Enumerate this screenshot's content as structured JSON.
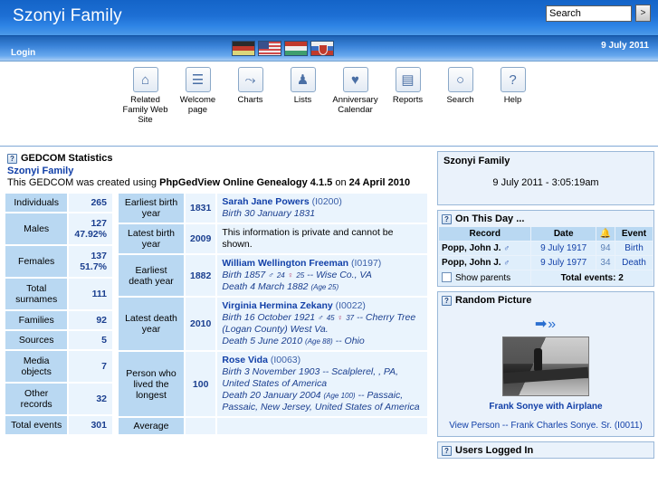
{
  "header": {
    "site_title": "Szonyi Family",
    "search_value": "Search",
    "search_go_label": ">",
    "login_label": "Login",
    "date": "9 July 2011",
    "flags": [
      "german-flag",
      "usa-flag",
      "hungary-flag",
      "slovakia-flag"
    ]
  },
  "toolbar": [
    {
      "icon": "home-icon",
      "glyph": "⌂",
      "label": "Related Family Web Site"
    },
    {
      "icon": "list-lines-icon",
      "glyph": "☰",
      "label": "Welcome page"
    },
    {
      "icon": "chart-icon",
      "glyph": "⤳",
      "label": "Charts"
    },
    {
      "icon": "person-icon",
      "glyph": "♟",
      "label": "Lists"
    },
    {
      "icon": "calendar-heart-icon",
      "glyph": "♥",
      "label": "Anniversary Calendar"
    },
    {
      "icon": "report-icon",
      "glyph": "▤",
      "label": "Reports"
    },
    {
      "icon": "magnifier-icon",
      "glyph": "○",
      "label": "Search"
    },
    {
      "icon": "question-icon",
      "glyph": "?",
      "label": "Help"
    }
  ],
  "gedcom": {
    "panel_title": "GEDCOM Statistics",
    "help_glyph": "?",
    "family_link": "Szonyi Family",
    "desc_prefix": "This GEDCOM was created using ",
    "desc_software": "PhpGedView Online Genealogy 4.1.5",
    "desc_mid": " on ",
    "desc_date": "24 April 2010"
  },
  "stats_left": [
    {
      "label": "Individuals",
      "value": "265"
    },
    {
      "label": "Males",
      "value": "127\n47.92%"
    },
    {
      "label": "Females",
      "value": "137\n51.7%"
    },
    {
      "label": "Total surnames",
      "value": "111"
    },
    {
      "label": "Families",
      "value": "92"
    },
    {
      "label": "Sources",
      "value": "5"
    },
    {
      "label": "Media objects",
      "value": "7"
    },
    {
      "label": "Other records",
      "value": "32"
    },
    {
      "label": "Total events",
      "value": "301"
    }
  ],
  "stats_right": [
    {
      "label": "Earliest birth year",
      "value": "1831",
      "private": false,
      "name": "Sarah Jane Powers",
      "xref": "(I0200)",
      "lines": [
        {
          "text": "Birth 30 January 1831"
        }
      ]
    },
    {
      "label": "Latest birth year",
      "value": "2009",
      "private": true,
      "private_text": "This information is private and cannot be shown."
    },
    {
      "label": "Earliest death year",
      "value": "1882",
      "private": false,
      "name": "William Wellington Freeman",
      "xref": "(I0197)",
      "lines": [
        {
          "text": "Birth 1857",
          "male_age": "24",
          "female_age": "25",
          "tail": "-- Wise Co., VA"
        },
        {
          "text": "Death 4 March 1882",
          "age": "(Age 25)"
        }
      ]
    },
    {
      "label": "Latest death year",
      "value": "2010",
      "private": false,
      "name": "Virginia Hermina Zekany",
      "xref": "(I0022)",
      "lines": [
        {
          "text": "Birth 16 October 1921",
          "male_age": "45",
          "female_age": "37",
          "tail": "-- Cherry Tree (Logan County) West Va."
        },
        {
          "text": "Death 5 June 2010",
          "age": "(Age 88)",
          "tail": "-- Ohio"
        }
      ]
    },
    {
      "label": "Person who lived the longest",
      "value": "100",
      "private": false,
      "name": "Rose Vida",
      "xref": "(I0063)",
      "lines": [
        {
          "text": "Birth 3 November 1903 -- Scalplerel, , PA, United States of America"
        },
        {
          "text": "Death 20 January 2004",
          "age": "(Age 100)",
          "tail": "-- Passaic, Passaic, New Jersey, United States of America"
        }
      ]
    },
    {
      "label": "Average",
      "value": "",
      "private": false,
      "name": "",
      "xref": "",
      "lines": []
    }
  ],
  "welcome_block": {
    "title": "Szonyi Family",
    "time": "9 July 2011 - 3:05:19am"
  },
  "on_this_day": {
    "panel_title": "On This Day ...",
    "help_glyph": "?",
    "columns": [
      "Record",
      "Date",
      "bell-icon",
      "Event"
    ],
    "rows": [
      {
        "record": "Popp, John J.",
        "sex": "♂",
        "date": "9 July 1917",
        "age": "94",
        "event": "Birth"
      },
      {
        "record": "Popp, John J.",
        "sex": "♂",
        "date": "9 July 1977",
        "age": "34",
        "event": "Death"
      }
    ],
    "show_parents_label": "Show parents",
    "total_label": "Total events: 2"
  },
  "random_picture": {
    "panel_title": "Random Picture",
    "help_glyph": "?",
    "arrows": "➡»",
    "caption": "Frank Sonye with Airplane",
    "view_person": "View Person -- Frank Charles Sonye. Sr.  (I0011)"
  },
  "users_logged_in": {
    "panel_title": "Users Logged In",
    "help_glyph": "?"
  }
}
